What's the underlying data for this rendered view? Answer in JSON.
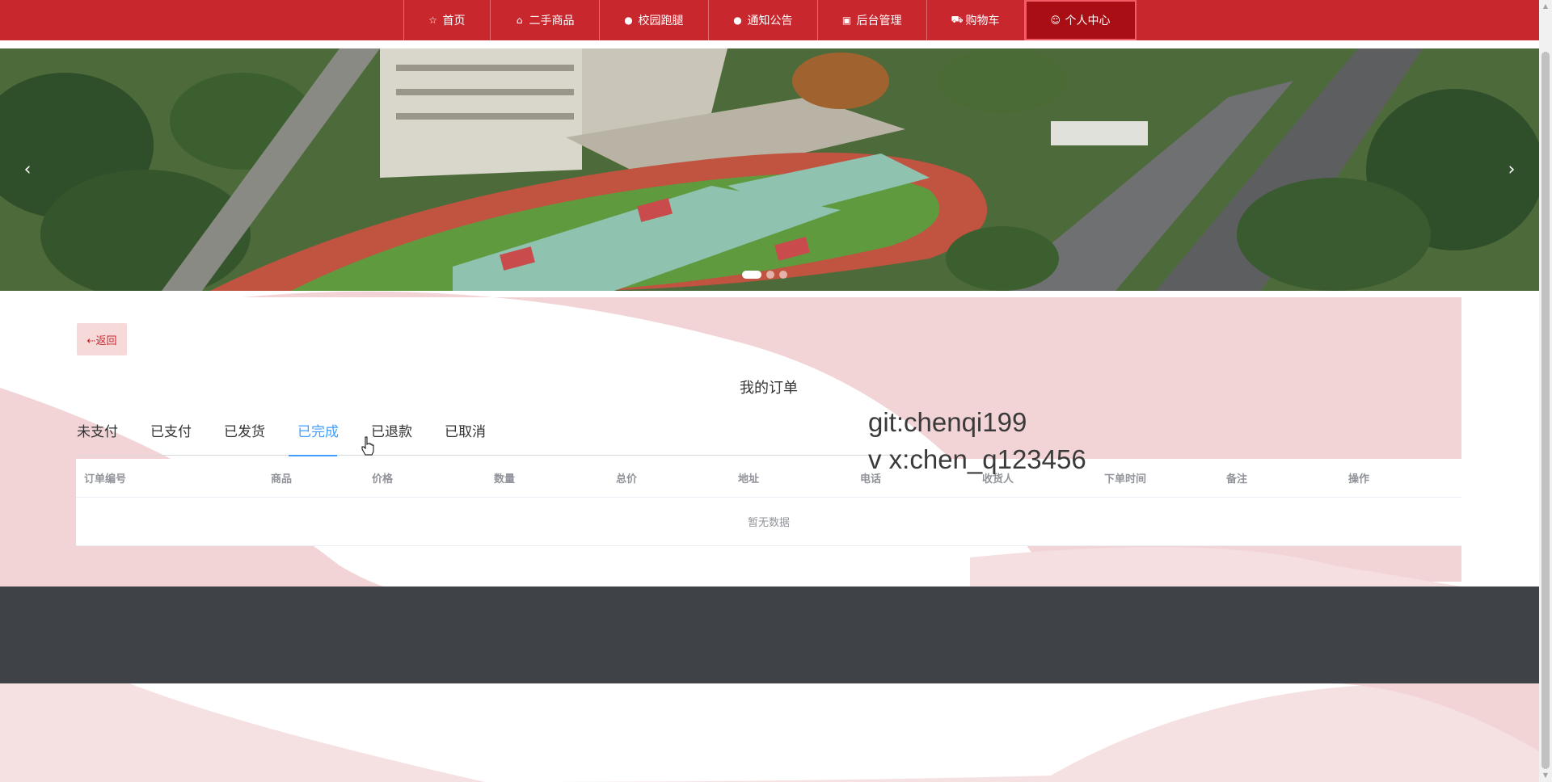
{
  "nav": {
    "items": [
      {
        "label": "首页",
        "icon": "star-icon",
        "glyph": "☆"
      },
      {
        "label": "二手商品",
        "icon": "bag-icon",
        "glyph": "⌂"
      },
      {
        "label": "校园跑腿",
        "icon": "alert-circle-icon",
        "glyph": "●"
      },
      {
        "label": "通知公告",
        "icon": "help-circle-icon",
        "glyph": "●"
      },
      {
        "label": "后台管理",
        "icon": "clipboard-icon",
        "glyph": "▣"
      },
      {
        "label": "购物车",
        "icon": "cart-icon",
        "glyph": "⛟"
      },
      {
        "label": "个人中心",
        "icon": "user-icon",
        "glyph": "☺"
      }
    ],
    "active_index": 6
  },
  "banner": {
    "prev": "‹",
    "next": "›",
    "slides": 3,
    "active_slide": 0
  },
  "orders": {
    "back_label": "⇠返回",
    "title": "我的订单",
    "tabs": [
      "未支付",
      "已支付",
      "已发货",
      "已完成",
      "已退款",
      "已取消"
    ],
    "active_tab": 3,
    "columns": [
      "订单编号",
      "商品",
      "价格",
      "数量",
      "总价",
      "地址",
      "电话",
      "收货人",
      "下单时间",
      "备注",
      "操作"
    ],
    "empty_text": "暂无数据"
  },
  "watermark": {
    "line1": "git:chenqi199",
    "line2": "v x:chen_q123456"
  },
  "colors": {
    "nav_bg": "#c8272e",
    "nav_active": "#a80e14",
    "accent_tab": "#409eff",
    "footer_bg": "#3f4246",
    "wave_pink": "#f2d4d6"
  }
}
